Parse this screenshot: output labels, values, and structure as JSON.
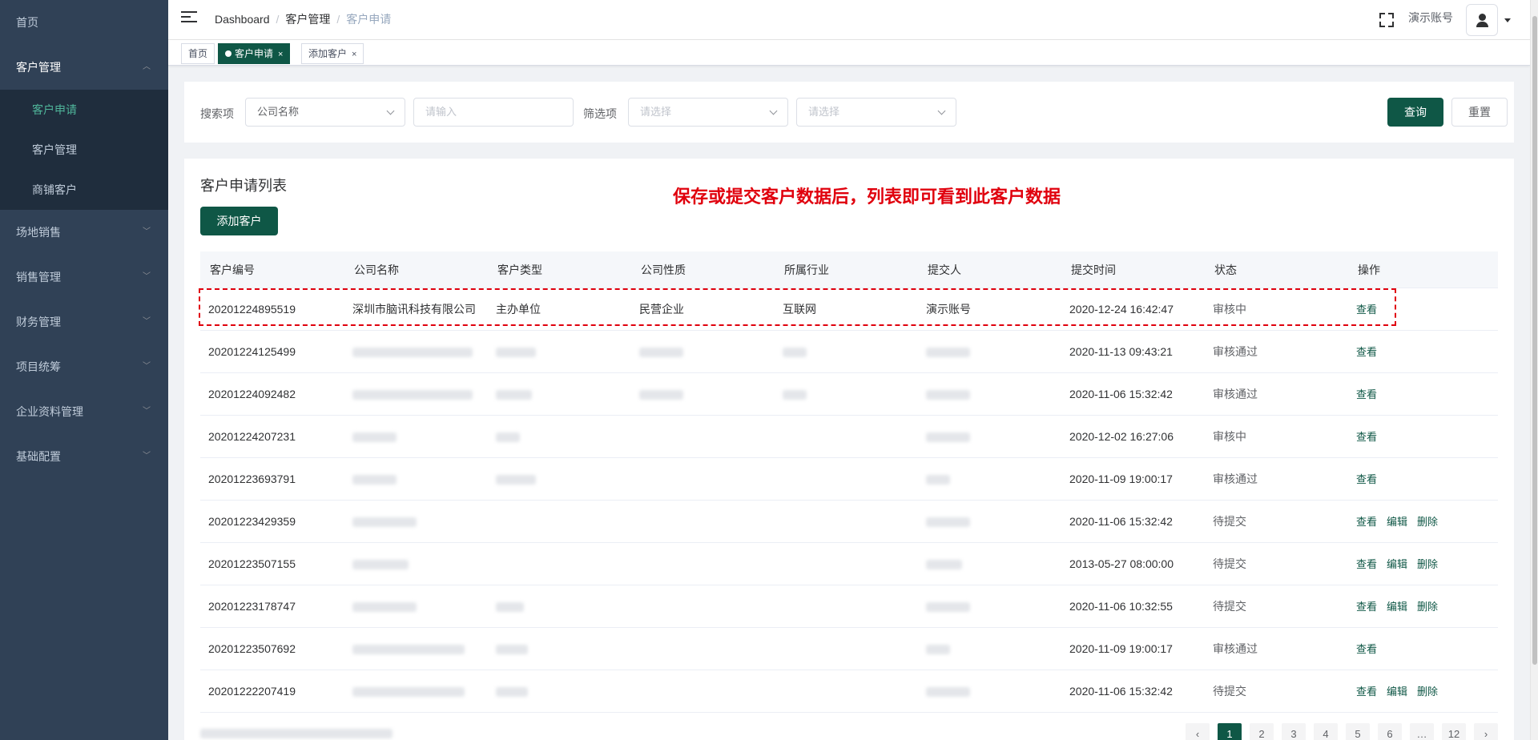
{
  "sidebar": {
    "items": [
      {
        "label": "首页",
        "open": false,
        "children": []
      },
      {
        "label": "客户管理",
        "open": true,
        "children": [
          "客户申请",
          "客户管理",
          "商铺客户"
        ]
      },
      {
        "label": "场地销售"
      },
      {
        "label": "销售管理"
      },
      {
        "label": "财务管理"
      },
      {
        "label": "项目统筹"
      },
      {
        "label": "企业资料管理"
      },
      {
        "label": "基础配置"
      }
    ],
    "active_sub": "客户申请"
  },
  "navbar": {
    "breadcrumb": [
      "Dashboard",
      "客户管理",
      "客户申请"
    ],
    "account_name": "演示账号"
  },
  "tags": [
    {
      "label": "首页",
      "active": false
    },
    {
      "label": "客户申请",
      "active": true,
      "close": "×"
    },
    {
      "label": "添加客户",
      "active": false,
      "close": "×"
    }
  ],
  "filter": {
    "search_label": "搜索项",
    "search_select": "公司名称",
    "search_input_placeholder": "请输入",
    "filter_label": "筛选项",
    "filter_select1_placeholder": "请选择",
    "filter_select2_placeholder": "请选择",
    "query_button": "查询",
    "reset_button": "重置"
  },
  "list": {
    "title": "客户申请列表",
    "add_button": "添加客户",
    "annotation": "保存或提交客户数据后，列表即可看到此客户数据",
    "columns": [
      "客户编号",
      "公司名称",
      "客户类型",
      "公司性质",
      "所属行业",
      "提交人",
      "提交时间",
      "状态",
      "操作"
    ],
    "ops": {
      "view": "查看",
      "edit": "编辑",
      "delete": "删除"
    },
    "rows": [
      {
        "id": "20201224895519",
        "company": "深圳市脑讯科技有限公司",
        "type": "主办单位",
        "nature": "民营企业",
        "industry": "互联网",
        "submitter": "演示账号",
        "time": "2020-12-24 16:42:47",
        "status": "审核中",
        "ops": [
          "view"
        ]
      },
      {
        "id": "20201224125499",
        "time": "2020-11-13 09:43:21",
        "status": "审核通过",
        "ops": [
          "view"
        ]
      },
      {
        "id": "20201224092482",
        "time": "2020-11-06 15:32:42",
        "status": "审核通过",
        "ops": [
          "view"
        ]
      },
      {
        "id": "20201224207231",
        "time": "2020-12-02 16:27:06",
        "status": "审核中",
        "ops": [
          "view"
        ]
      },
      {
        "id": "20201223693791",
        "time": "2020-11-09 19:00:17",
        "status": "审核通过",
        "ops": [
          "view"
        ]
      },
      {
        "id": "20201223429359",
        "time": "2020-11-06 15:32:42",
        "status": "待提交",
        "ops": [
          "view",
          "edit",
          "delete"
        ]
      },
      {
        "id": "20201223507155",
        "time": "2013-05-27 08:00:00",
        "status": "待提交",
        "ops": [
          "view",
          "edit",
          "delete"
        ]
      },
      {
        "id": "20201223178747",
        "time": "2020-11-06 10:32:55",
        "status": "待提交",
        "ops": [
          "view",
          "edit",
          "delete"
        ]
      },
      {
        "id": "20201223507692",
        "time": "2020-11-09 19:00:17",
        "status": "审核通过",
        "ops": [
          "view"
        ]
      },
      {
        "id": "20201222207419",
        "time": "2020-11-06 15:32:42",
        "status": "待提交",
        "ops": [
          "view",
          "edit",
          "delete"
        ]
      }
    ]
  },
  "pagination": {
    "pages": [
      "1",
      "2",
      "3",
      "4",
      "5",
      "6"
    ],
    "last": "12",
    "current": "1"
  }
}
